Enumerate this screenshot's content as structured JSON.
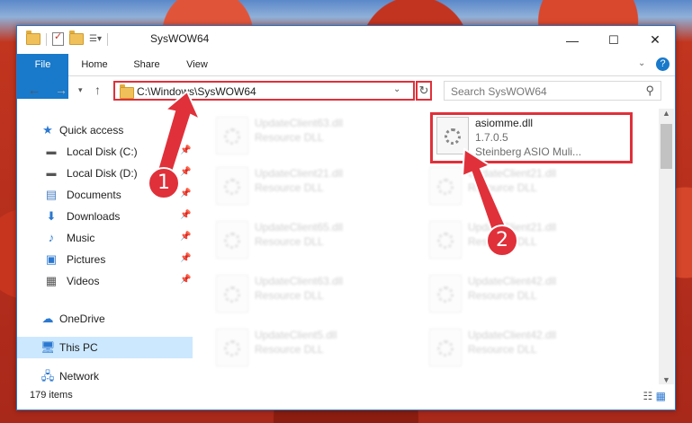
{
  "window": {
    "title": "SysWOW64"
  },
  "window_controls": {
    "minimize": "—",
    "maximize": "☐",
    "close": "✕"
  },
  "ribbon": {
    "tabs": [
      "File",
      "Home",
      "Share",
      "View"
    ]
  },
  "address": {
    "path": "C:\\Windows\\SysWOW64",
    "search_placeholder": "Search SysWOW64"
  },
  "sidebar": {
    "items": [
      {
        "label": "Quick access",
        "icon": "star-icon"
      },
      {
        "label": "Local Disk (C:)",
        "icon": "drive-icon",
        "pinned": true
      },
      {
        "label": "Local Disk (D:)",
        "icon": "drive-icon",
        "pinned": true
      },
      {
        "label": "Documents",
        "icon": "documents-icon",
        "pinned": true
      },
      {
        "label": "Downloads",
        "icon": "download-icon",
        "pinned": true
      },
      {
        "label": "Music",
        "icon": "music-icon",
        "pinned": true
      },
      {
        "label": "Pictures",
        "icon": "pictures-icon",
        "pinned": true
      },
      {
        "label": "Videos",
        "icon": "videos-icon",
        "pinned": true
      },
      {
        "label": "OneDrive",
        "icon": "cloud-icon"
      },
      {
        "label": "This PC",
        "icon": "computer-icon",
        "selected": true
      },
      {
        "label": "Network",
        "icon": "network-icon"
      }
    ]
  },
  "files": {
    "col1": [
      {
        "name": "UpdateClient63.dll",
        "desc": "Resource DLL"
      },
      {
        "name": "UpdateClient21.dll",
        "desc": "Resource DLL"
      },
      {
        "name": "UpdateClient65.dll",
        "desc": "Resource DLL"
      },
      {
        "name": "UpdateClient63.dll",
        "desc": "Resource DLL"
      },
      {
        "name": "UpdateClient5.dll",
        "desc": "Resource DLL"
      }
    ],
    "col2": [
      {
        "name": "UpdateClient21.dll",
        "desc": "Resource DLL"
      },
      {
        "name": "UpdateClient21.dll",
        "desc": "Resource DLL"
      },
      {
        "name": "UpdateClient42.dll",
        "desc": "Resource DLL"
      },
      {
        "name": "UpdateClient42.dll",
        "desc": "Resource DLL"
      }
    ],
    "highlighted": {
      "name": "asiomme.dll",
      "version": "1.7.0.5",
      "desc": "Steinberg ASIO Muli..."
    }
  },
  "status": {
    "count": "179 items"
  },
  "callouts": [
    "1",
    "2"
  ],
  "colors": {
    "accent": "#1979ca",
    "highlight": "#e0303a",
    "selected": "#cce8ff"
  }
}
